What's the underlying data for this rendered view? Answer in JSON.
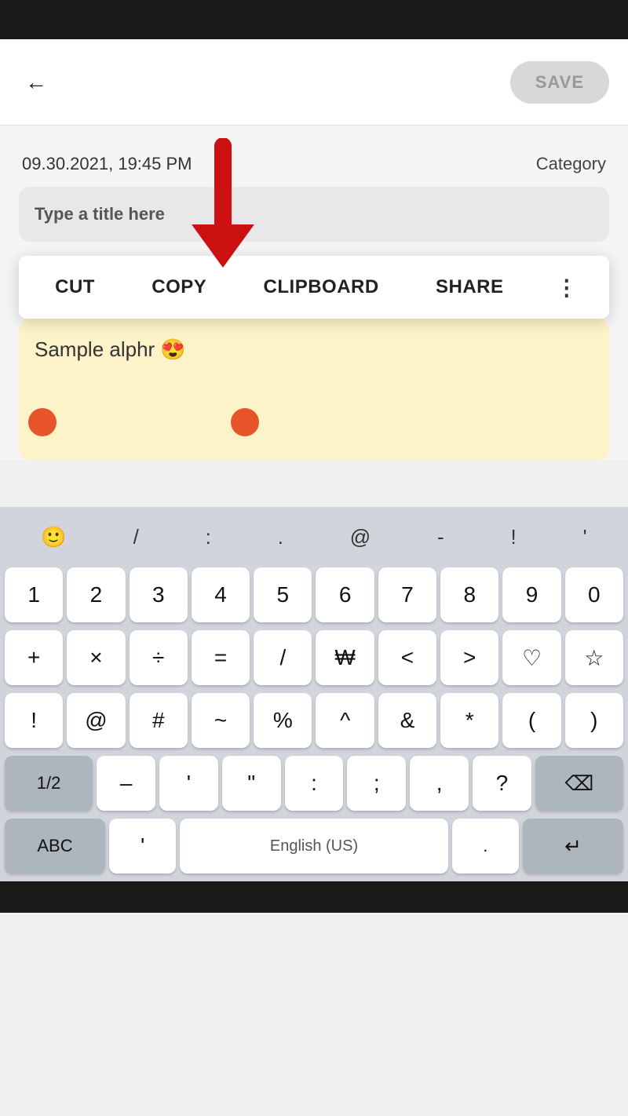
{
  "statusBar": {},
  "header": {
    "back_label": "←",
    "save_label": "SAVE"
  },
  "note": {
    "date": "09.30.2021, 19:45 PM",
    "category": "Category",
    "title_placeholder": "Type a title here",
    "content": "Sample alphr 😍"
  },
  "contextMenu": {
    "cut": "CUT",
    "copy": "COPY",
    "clipboard": "CLIPBOARD",
    "share": "SHARE",
    "more": "⋮"
  },
  "keyboard": {
    "special_row": [
      "🙂",
      "/",
      ":",
      ".",
      "@",
      "-",
      "!",
      "'"
    ],
    "row1": [
      "1",
      "2",
      "3",
      "4",
      "5",
      "6",
      "7",
      "8",
      "9",
      "0"
    ],
    "row2": [
      "+",
      "×",
      "÷",
      "=",
      "/",
      "₩",
      "<",
      ">",
      "♡",
      "☆"
    ],
    "row3": [
      "!",
      "@",
      "#",
      "~",
      "%",
      "^",
      "&",
      "*",
      "(",
      ")"
    ],
    "row4_left": "1/2",
    "row4_keys": [
      "–",
      "'",
      "\"",
      ":",
      ";",
      ",",
      "?"
    ],
    "row4_right": "⌫",
    "row5_left": "ABC",
    "row5_apostrophe": "'",
    "space_label": "English (US)",
    "row5_right": "↵"
  }
}
